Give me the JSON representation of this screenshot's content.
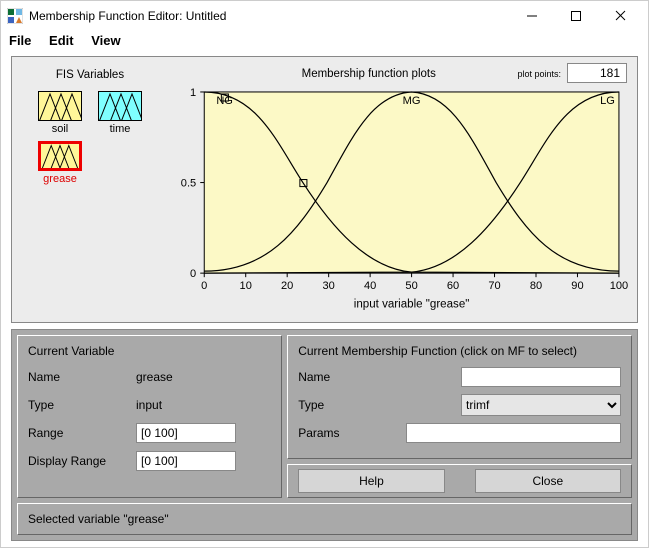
{
  "window": {
    "title": "Membership Function Editor: Untitled"
  },
  "menu": {
    "file": "File",
    "edit": "Edit",
    "view": "View"
  },
  "fis": {
    "title": "FIS Variables",
    "vars": [
      {
        "name": "soil"
      },
      {
        "name": "time"
      },
      {
        "name": "grease"
      }
    ]
  },
  "plot": {
    "title": "Membership function plots",
    "plotpoints_label": "plot points:",
    "plotpoints": "181",
    "xlabel": "input variable \"grease\"",
    "mf_labels": {
      "ng": "NG",
      "mg": "MG",
      "lg": "LG"
    }
  },
  "current_var": {
    "title": "Current Variable",
    "name_label": "Name",
    "name": "grease",
    "type_label": "Type",
    "type": "input",
    "range_label": "Range",
    "range": "[0 100]",
    "disprange_label": "Display Range",
    "disprange": "[0 100]"
  },
  "current_mf": {
    "title": "Current Membership Function (click on MF to select)",
    "name_label": "Name",
    "name": "",
    "type_label": "Type",
    "type": "trimf",
    "params_label": "Params",
    "params": ""
  },
  "buttons": {
    "help": "Help",
    "close": "Close"
  },
  "status": "Selected variable \"grease\"",
  "chart_data": {
    "type": "line",
    "title": "Membership function plots",
    "xlabel": "input variable \"grease\"",
    "ylabel": "",
    "xlim": [
      0,
      100
    ],
    "ylim": [
      0,
      1
    ],
    "xticks": [
      0,
      10,
      20,
      30,
      40,
      50,
      60,
      70,
      80,
      90,
      100
    ],
    "yticks": [
      0,
      0.5,
      1
    ],
    "series": [
      {
        "name": "NG",
        "type": "gaussmf",
        "sigma": 20,
        "c": 0,
        "x": [
          0,
          5,
          10,
          15,
          20,
          25,
          30,
          35,
          40,
          45,
          50,
          55,
          60,
          70,
          80,
          90,
          100
        ],
        "y": [
          1.0,
          0.97,
          0.88,
          0.75,
          0.61,
          0.46,
          0.32,
          0.22,
          0.14,
          0.08,
          0.04,
          0.02,
          0.01,
          0.0,
          0.0,
          0.0,
          0.0
        ]
      },
      {
        "name": "MG",
        "type": "gaussmf",
        "sigma": 20,
        "c": 50,
        "x": [
          0,
          5,
          10,
          15,
          20,
          25,
          30,
          35,
          40,
          45,
          50,
          55,
          60,
          65,
          70,
          75,
          80,
          85,
          90,
          95,
          100
        ],
        "y": [
          0.04,
          0.08,
          0.14,
          0.22,
          0.32,
          0.46,
          0.61,
          0.75,
          0.88,
          0.97,
          1.0,
          0.97,
          0.88,
          0.75,
          0.61,
          0.46,
          0.32,
          0.22,
          0.14,
          0.08,
          0.04
        ]
      },
      {
        "name": "LG",
        "type": "gaussmf",
        "sigma": 20,
        "c": 100,
        "x": [
          0,
          10,
          20,
          30,
          40,
          45,
          50,
          55,
          60,
          65,
          70,
          75,
          80,
          85,
          90,
          95,
          100
        ],
        "y": [
          0.0,
          0.0,
          0.0,
          0.0,
          0.01,
          0.02,
          0.04,
          0.08,
          0.14,
          0.22,
          0.32,
          0.46,
          0.61,
          0.75,
          0.88,
          0.97,
          1.0
        ]
      }
    ],
    "markers": [
      {
        "series": "NG",
        "x": 5,
        "y": 0.97
      },
      {
        "series": "NG",
        "x": 24,
        "y": 0.5
      }
    ]
  }
}
